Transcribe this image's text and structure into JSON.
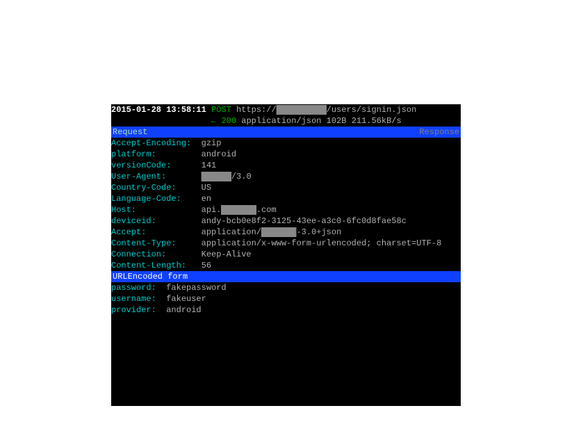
{
  "request": {
    "timestamp": "2015-01-28 13:58:11",
    "method": "POST",
    "url_proto": "https://",
    "url_host_redacted": "██████████",
    "url_path": "/users/signin.json",
    "response_arrow": "←",
    "status": "200",
    "content_type": "application/json",
    "size": "102B",
    "speed": "211.56kB/s"
  },
  "tabs": {
    "left": "Request",
    "right": "Response"
  },
  "headers": [
    {
      "key": "Accept-Encoding:",
      "value": "gzip"
    },
    {
      "key": "platform:",
      "value": "android"
    },
    {
      "key": "versionCode:",
      "value": "141"
    },
    {
      "key": "User-Agent:",
      "value_pre": "",
      "redacted": "██████",
      "value_post": "/3.0"
    },
    {
      "key": "Country-Code:",
      "value": "US"
    },
    {
      "key": "Language-Code:",
      "value": "en"
    },
    {
      "key": "Host:",
      "value_pre": "api.",
      "redacted": "███████",
      "value_post": ".com"
    },
    {
      "key": "deviceid:",
      "value": "andy-bcb0e8f2-3125-43ee-a3c0-6fc0d8fae58c"
    },
    {
      "key": "Accept:",
      "value_pre": "application/",
      "redacted": "███████",
      "value_post": "-3.0+json"
    },
    {
      "key": "Content-Type:",
      "value": "application/x-www-form-urlencoded; charset=UTF-8"
    },
    {
      "key": "Connection:",
      "value": "Keep-Alive"
    },
    {
      "key": "Content-Length:",
      "value": "56"
    }
  ],
  "form_section": "URLEncoded form",
  "form": [
    {
      "key": "password:",
      "value": "fakepassword"
    },
    {
      "key": "username:",
      "value": "fakeuser"
    },
    {
      "key": "provider:",
      "value": "android"
    }
  ],
  "col_header_key": 16
}
